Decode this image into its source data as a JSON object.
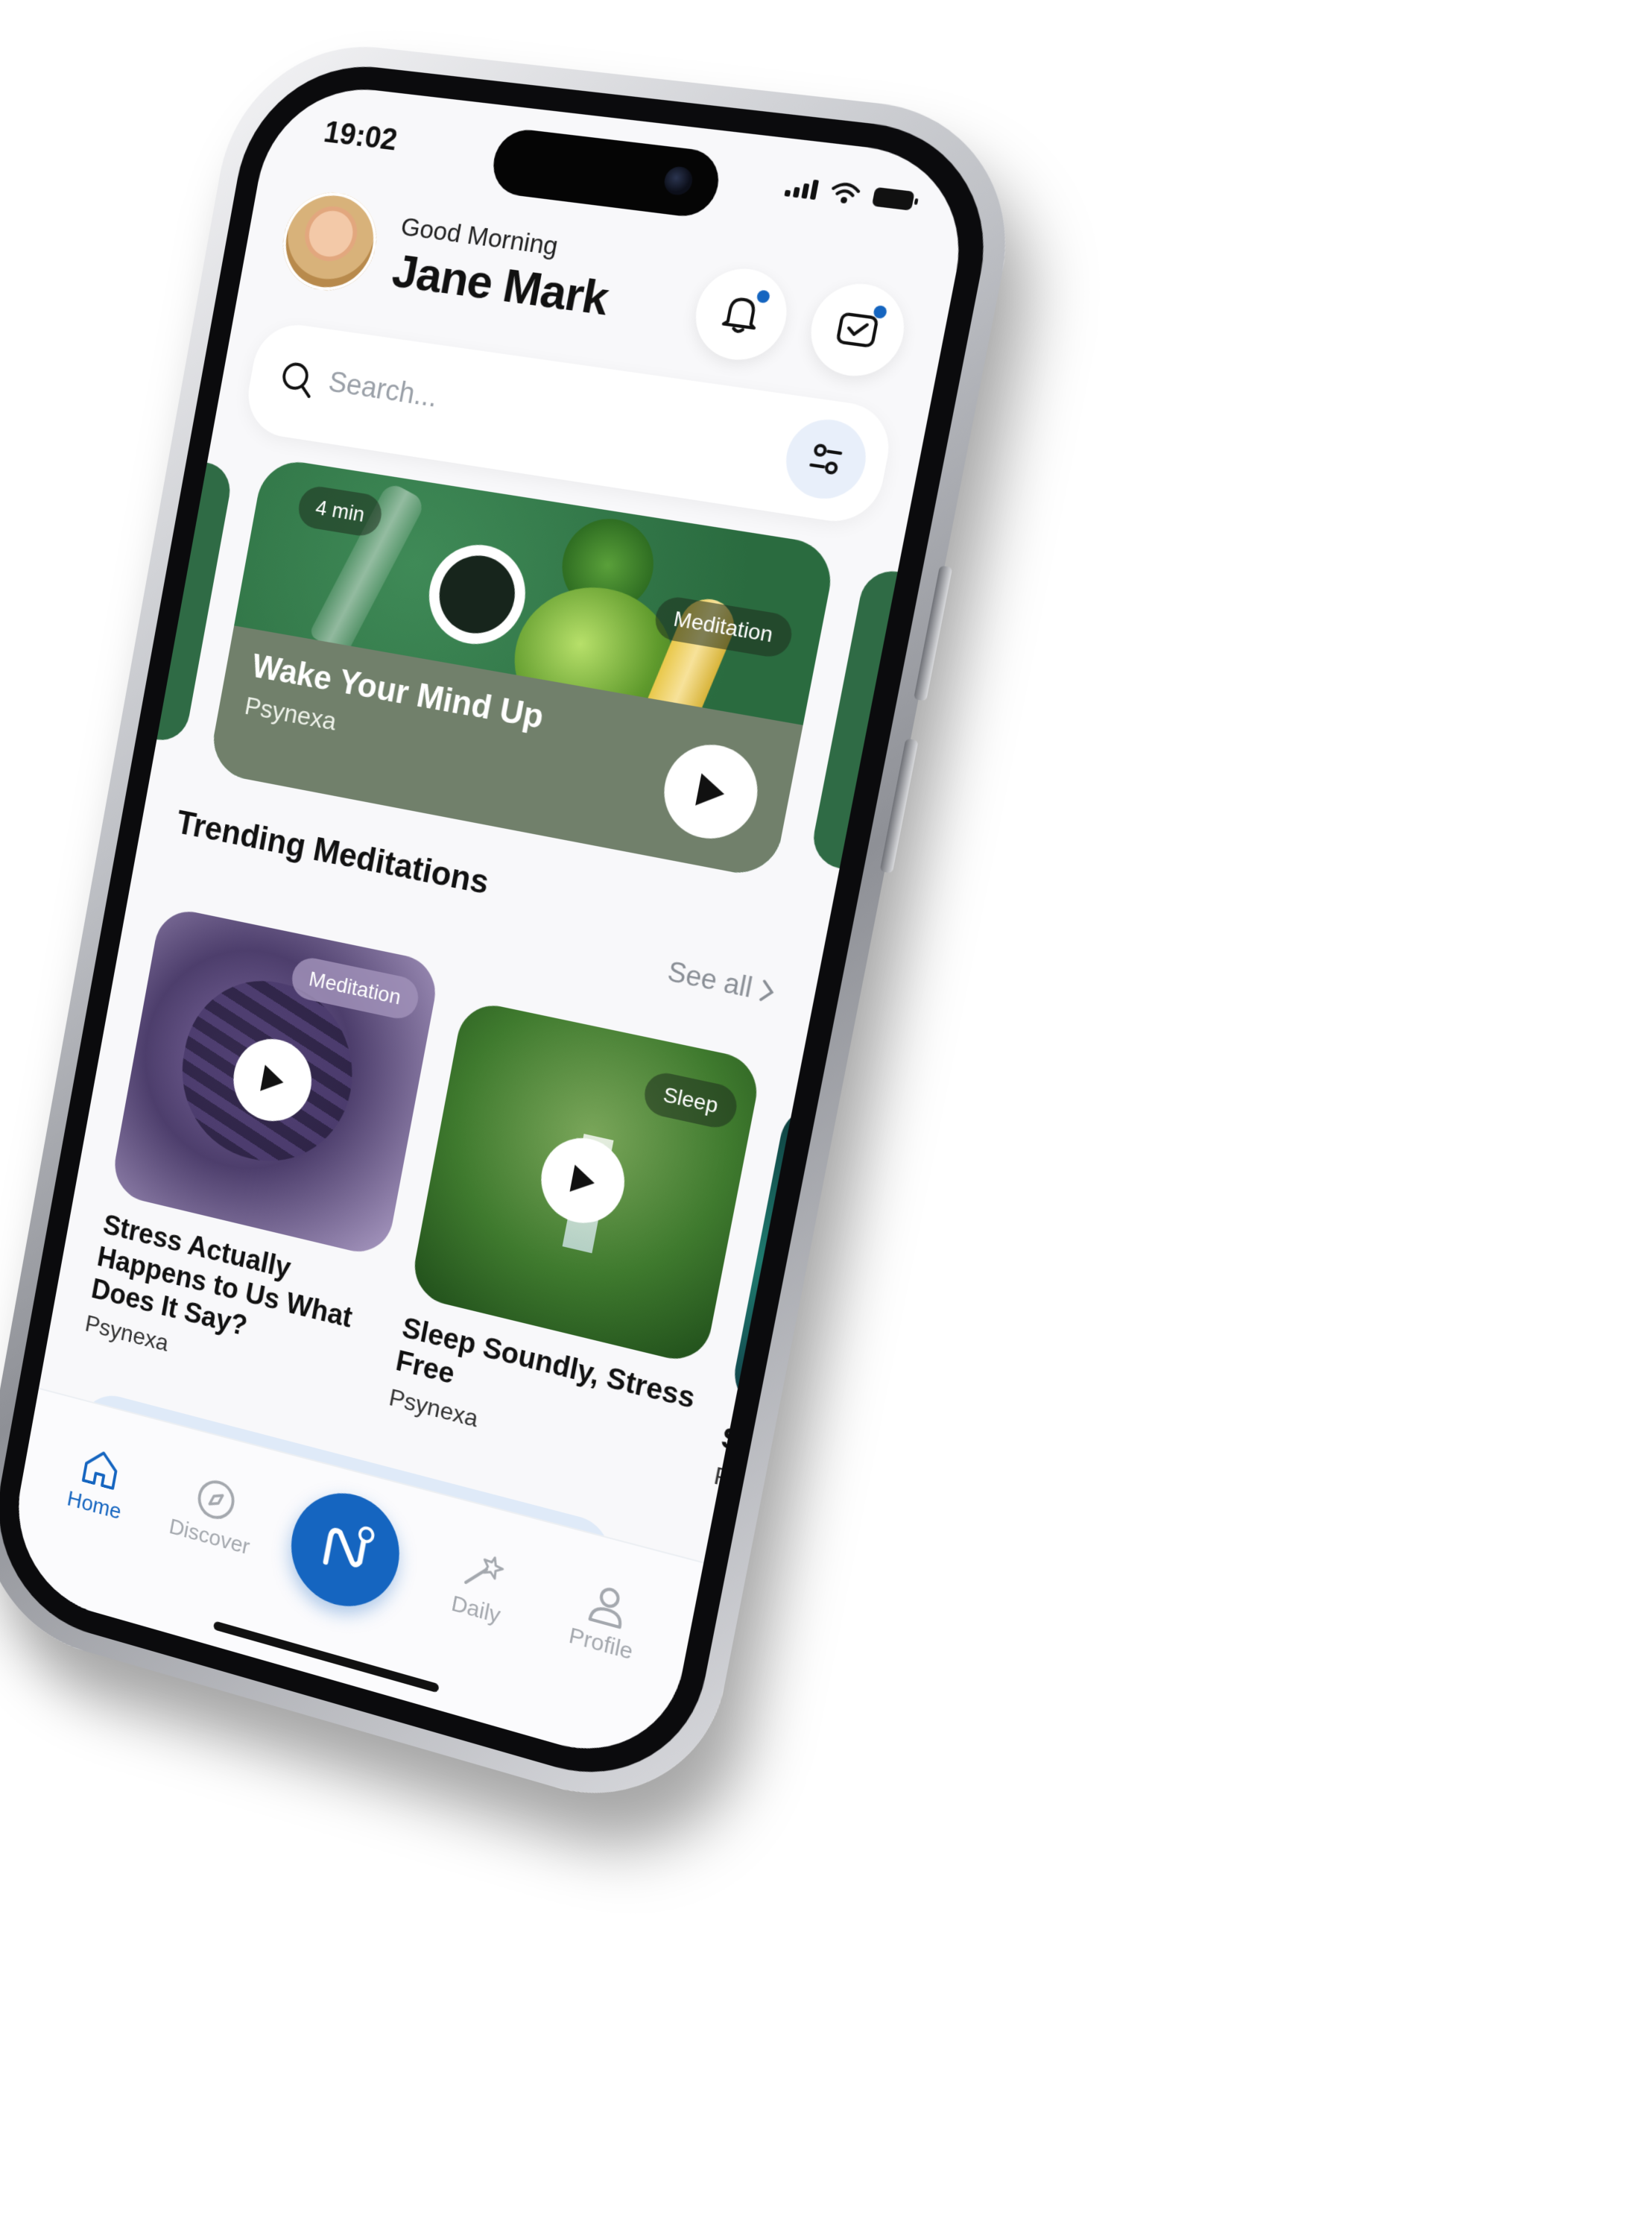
{
  "status_bar": {
    "time": "19:02"
  },
  "header": {
    "greeting": "Good Morning",
    "user_name": "Jane Mark",
    "notification_icon": "bell-icon",
    "inbox_icon": "mail-icon"
  },
  "search": {
    "placeholder": "Search...",
    "icon": "search-icon",
    "filter_icon": "filter-icon"
  },
  "featured": {
    "duration": "4 min",
    "category": "Meditation",
    "title": "Wake Your Mind Up",
    "author": "Psynexa"
  },
  "trending": {
    "title": "Trending Meditations",
    "see_all": "See all",
    "items": [
      {
        "title": "Stress Actually Happens to Us What Does It Say?",
        "author": "Psynexa",
        "category": "Meditation"
      },
      {
        "title": "Sleep Soundly, Stress Free",
        "author": "Psynexa",
        "category": "Sleep"
      },
      {
        "title": "St Ne",
        "author": "Ps",
        "category": ""
      }
    ]
  },
  "tabs": [
    {
      "label": "Home",
      "icon": "home-icon",
      "active": true
    },
    {
      "label": "Discover",
      "icon": "compass-icon",
      "active": false
    },
    {
      "label": "",
      "icon": "brand-logo-icon",
      "active": false
    },
    {
      "label": "Daily",
      "icon": "magic-wand-icon",
      "active": false
    },
    {
      "label": "Profile",
      "icon": "user-icon",
      "active": false
    }
  ],
  "colors": {
    "accent": "#1565c0",
    "hero_green": "#2a6b3f",
    "hero_band": "#71806b",
    "promo_bg": "#dfeaf8"
  }
}
